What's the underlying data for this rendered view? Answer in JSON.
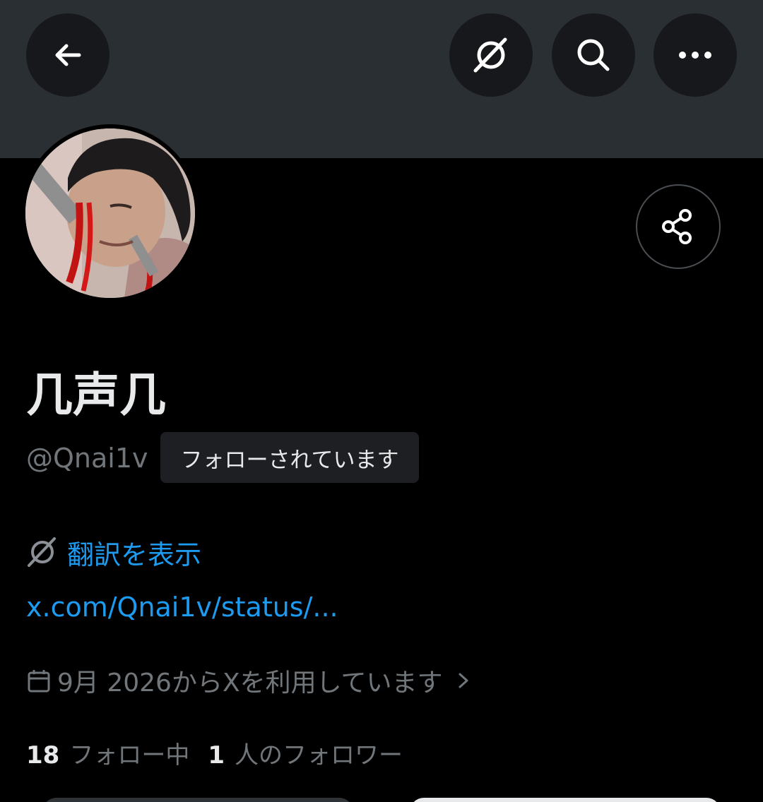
{
  "header": {
    "back_icon": "arrow-left-icon",
    "translate_icon": "translate-slash-icon",
    "search_icon": "search-icon",
    "more_icon": "more-horizontal-icon",
    "banner_color": "#2a2f34"
  },
  "profile": {
    "display_name": "几声几",
    "handle": "@Qnai1v",
    "follows_you_badge": "フォローされています",
    "share_icon": "share-icon",
    "translate_label": "翻訳を表示",
    "bio_link": "x.com/Qnai1v/status/...",
    "joined_text": "9月 2026からXを利用しています",
    "following_count": "18",
    "following_label": "フォロー中",
    "followers_count": "1",
    "followers_label": "人のフォロワー"
  },
  "colors": {
    "accent": "#1d9bf0",
    "muted": "#71767b",
    "text": "#e7e9ea",
    "background": "#000000"
  }
}
